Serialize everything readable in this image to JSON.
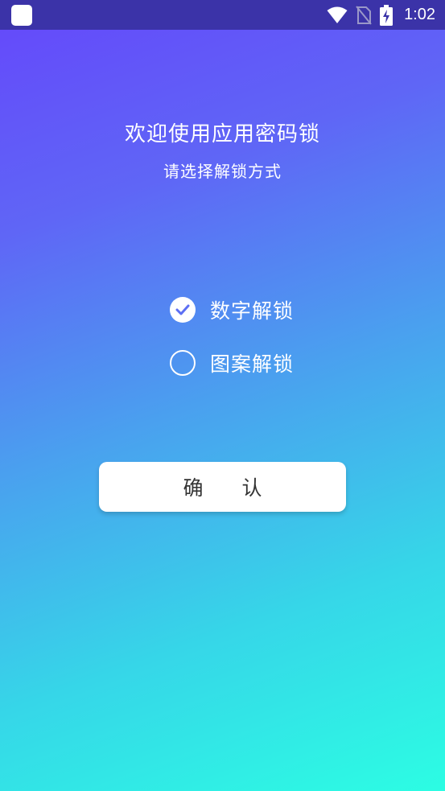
{
  "status_bar": {
    "time": "1:02",
    "icons": [
      "app-icon",
      "wifi-icon",
      "no-sim-icon",
      "battery-charging-icon"
    ]
  },
  "header": {
    "title": "欢迎使用应用密码锁",
    "subtitle": "请选择解锁方式"
  },
  "options": [
    {
      "label": "数字解锁",
      "checked": true
    },
    {
      "label": "图案解锁",
      "checked": false
    }
  ],
  "confirm_label": "确 认",
  "colors": {
    "gradient_start": "#6547fb",
    "gradient_end": "#2cfde3",
    "status_bar": "#3b33a8",
    "button_bg": "#ffffff",
    "button_text": "#333333"
  }
}
